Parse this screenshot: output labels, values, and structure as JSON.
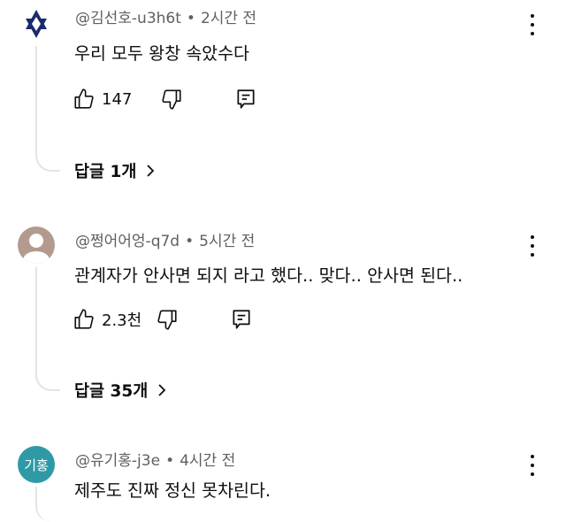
{
  "comments": [
    {
      "author": "@김선호-u3h6t",
      "separator": "•",
      "time": "2시간 전",
      "text": "우리 모두 왕창 속았수다",
      "likes": "147",
      "replies": "답글 1개",
      "avatar_type": "star",
      "avatar_color": "#1b2a6b"
    },
    {
      "author": "@쩡어어엉-q7d",
      "separator": "•",
      "time": "5시간 전",
      "text": "관계자가 안사면 되지 라고 했다..  맞다.. 안사면 된다..",
      "likes": "2.3천",
      "replies": "답글 35개",
      "avatar_type": "person",
      "avatar_color": "#b39a8e"
    },
    {
      "author": "@유기홍-j3e",
      "separator": "•",
      "time": "4시간 전",
      "text": "제주도 진짜 정신 못차린다.",
      "avatar_type": "initials",
      "avatar_text": "기홍",
      "avatar_color": "#2f9aa6"
    }
  ],
  "icons": {
    "like": "thumbs-up-icon",
    "dislike": "thumbs-down-icon",
    "reply": "reply-comment-icon",
    "more": "more-vertical-icon",
    "chevron": "chevron-right-icon"
  }
}
